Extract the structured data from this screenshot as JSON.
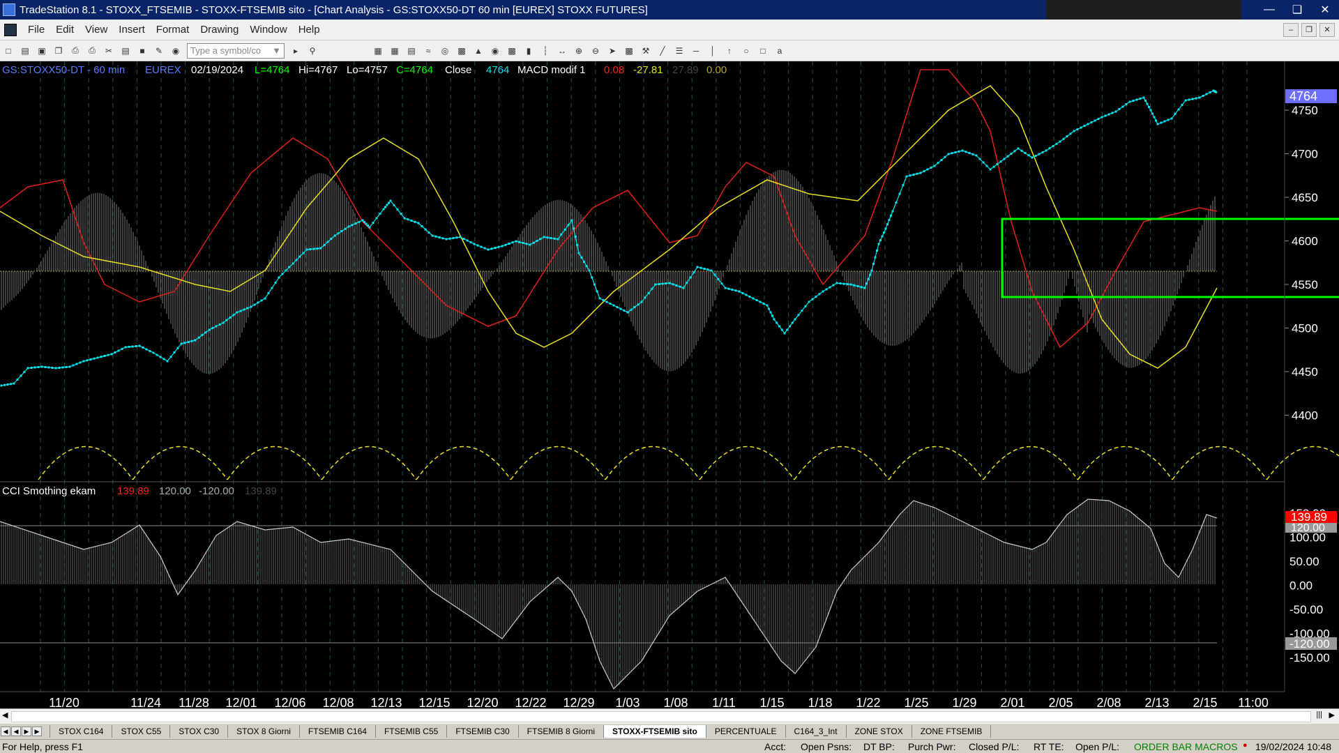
{
  "window": {
    "title": "TradeStation 8.1 - STOXX_FTSEMIB - STOXX-FTSEMIB sito - [Chart Analysis - GS:STOXX50-DT  60 min  [EUREX] STOXX FUTURES]"
  },
  "menu": {
    "items": [
      "File",
      "Edit",
      "View",
      "Insert",
      "Format",
      "Drawing",
      "Window",
      "Help"
    ]
  },
  "toolbar": {
    "symbol_placeholder": "Type a symbol/co"
  },
  "chart": {
    "header": {
      "symbol": "GS:STOXX50-DT - 60 min",
      "exchange": "EUREX",
      "date": "02/19/2024",
      "last": "L=4764",
      "high": "Hi=4767",
      "low": "Lo=4757",
      "close_val": "C=4764",
      "close_label": "Close",
      "close_value": "4764",
      "macd_name": "MACD modif 1",
      "macd_v1": "0.08",
      "macd_v2": "-27.81",
      "macd_v3": "27.89",
      "macd_v4": "0.00"
    },
    "price_axis": {
      "labels": [
        "4750",
        "4700",
        "4650",
        "4600",
        "4550",
        "4500",
        "4450",
        "4400"
      ],
      "last_price_tag": "4764"
    },
    "cci": {
      "name": "CCI Smothing ekam",
      "v1": "139.89",
      "v2": "120.00",
      "v3": "-120.00",
      "v4": "139.89",
      "axis_labels": [
        "150.00",
        "100.00",
        "50.00",
        "0.00",
        "-50.00",
        "-100.00",
        "-150.00"
      ],
      "tag_value": "139.89",
      "tag_upper": "120.00",
      "tag_lower": "-120.00"
    },
    "date_axis": [
      "11/20",
      "11/24",
      "11/28",
      "12/01",
      "12/06",
      "12/08",
      "12/13",
      "12/15",
      "12/20",
      "12/22",
      "12/29",
      "1/03",
      "1/08",
      "1/11",
      "1/15",
      "1/18",
      "1/22",
      "1/25",
      "1/29",
      "2/01",
      "2/05",
      "2/08",
      "2/13",
      "2/15",
      "11:00"
    ],
    "colors": {
      "price": "#00e5ee",
      "red_line": "#e0201a",
      "yellow_line": "#e8e020",
      "box": "#00ff00",
      "histo": "#808080",
      "tag_blue": "#6f6fff",
      "tag_red": "#ff0000"
    }
  },
  "tabs": [
    "STOX C164",
    "STOX C55",
    "STOX C30",
    "STOX 8 Giorni",
    "FTSEMIB C164",
    "FTSEMIB C55",
    "FTSEMIB C30",
    "FTSEMIB 8 Giorni",
    "STOXX-FTSEMIB sito",
    "PERCENTUALE",
    "C164_3_Int",
    "ZONE STOX",
    "ZONE FTSEMIB"
  ],
  "active_tab": "STOXX-FTSEMIB sito",
  "status": {
    "help": "For Help, press F1",
    "acct": "Acct:",
    "open_psns": "Open Psns:",
    "dt_bp": "DT BP:",
    "purch_pwr": "Purch Pwr:",
    "closed_pl": "Closed P/L:",
    "rt_te": "RT TE:",
    "open_pl": "Open P/L:",
    "macros": "ORDER BAR  MACROS",
    "datetime": "19/02/2024 10:48"
  }
}
